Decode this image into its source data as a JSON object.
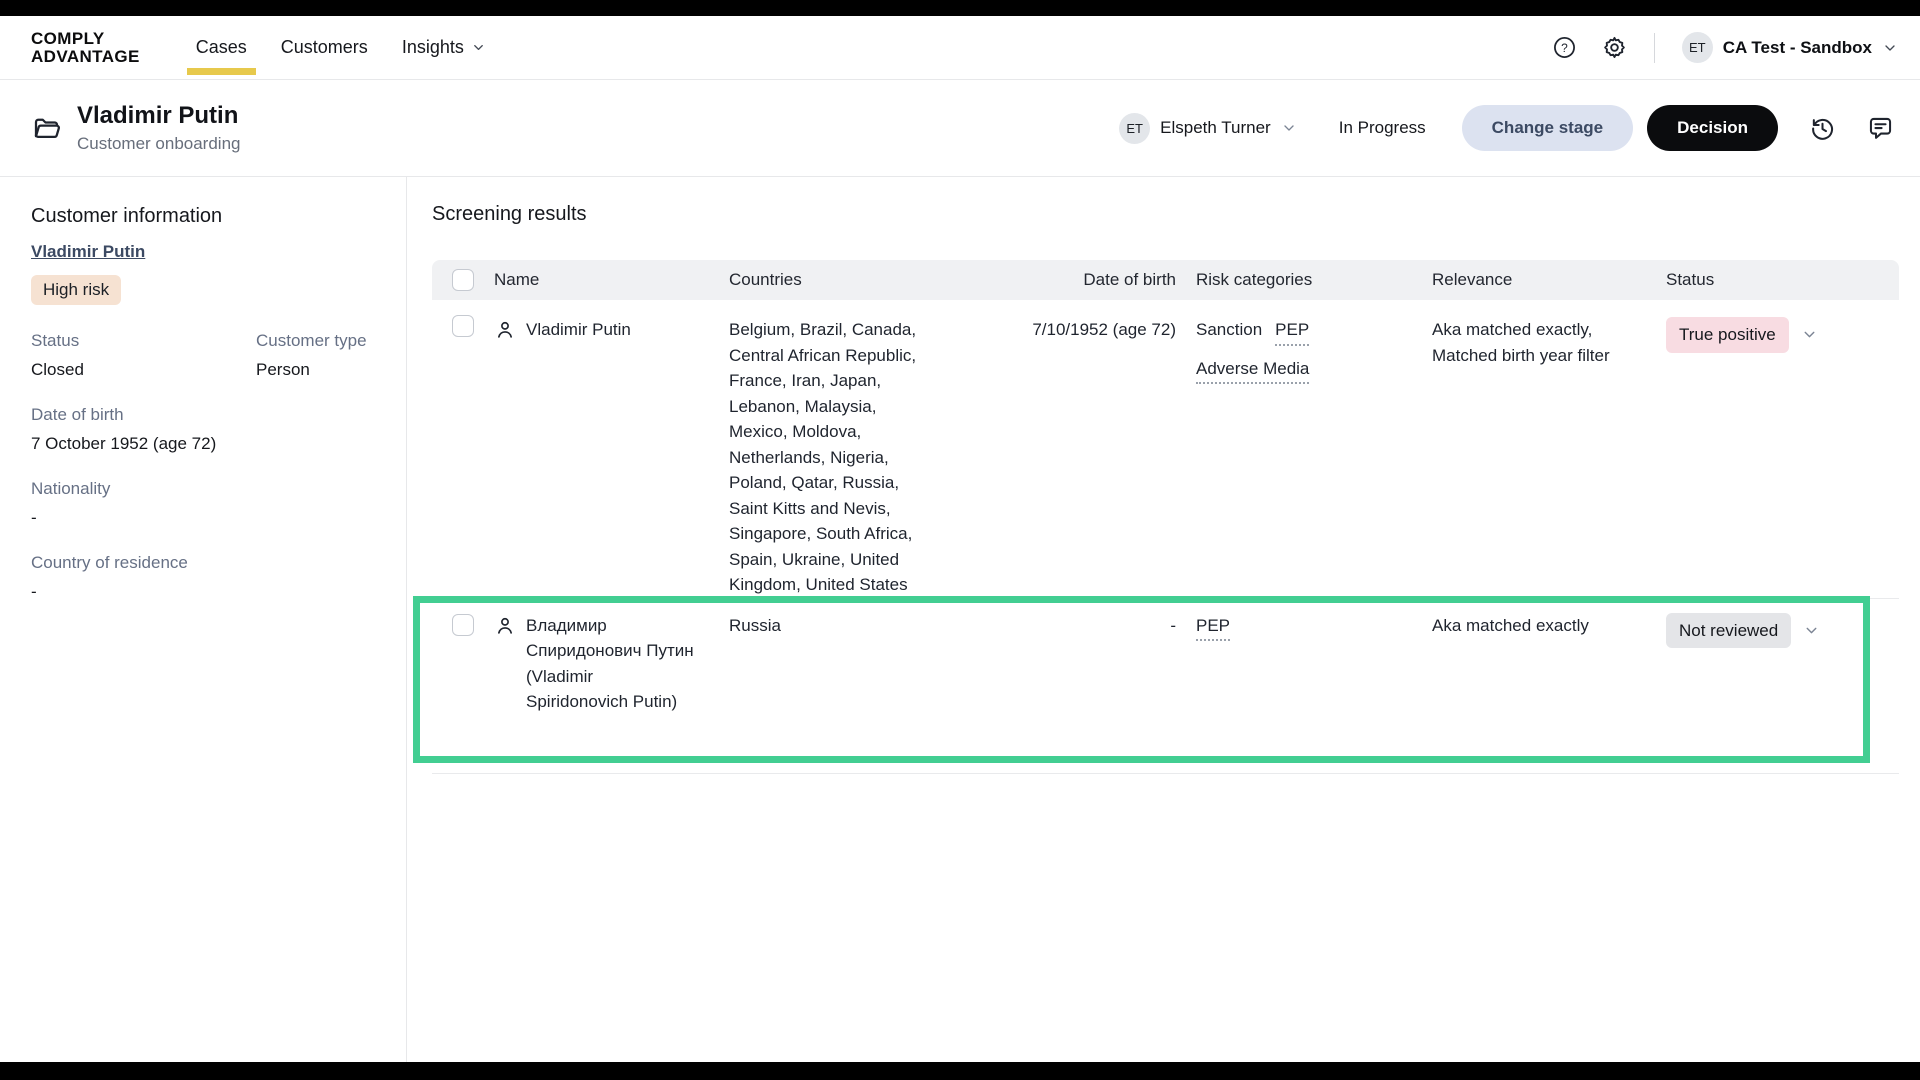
{
  "brand": {
    "logo_line1": "COMPLY",
    "logo_line2": "ADVANTAGE"
  },
  "nav": {
    "tabs": [
      {
        "label": "Cases",
        "active": true
      },
      {
        "label": "Customers",
        "active": false
      },
      {
        "label": "Insights",
        "active": false,
        "has_chevron": true
      }
    ],
    "account": {
      "avatar_initials": "ET",
      "label": "CA Test - Sandbox"
    }
  },
  "case_header": {
    "title": "Vladimir Putin",
    "subtitle": "Customer onboarding",
    "assignee": {
      "avatar_initials": "ET",
      "name": "Elspeth Turner"
    },
    "stage": "In Progress",
    "change_stage_label": "Change stage",
    "decision_label": "Decision"
  },
  "sidebar": {
    "heading": "Customer information",
    "customer_link": "Vladimir Putin",
    "risk_badge": "High risk",
    "fields": [
      {
        "label": "Status",
        "value": "Closed"
      },
      {
        "label": "Customer type",
        "value": "Person"
      },
      {
        "label": "Date of birth",
        "value": "7 October 1952 (age 72)"
      },
      {
        "label": "Nationality",
        "value": "-"
      },
      {
        "label": "Country of residence",
        "value": "-"
      }
    ]
  },
  "main": {
    "heading": "Screening results",
    "table": {
      "columns": [
        "Name",
        "Countries",
        "Date of birth",
        "Risk categories",
        "Relevance",
        "Status"
      ],
      "rows": [
        {
          "name": "Vladimir Putin",
          "countries": "Belgium, Brazil, Canada, Central African Republic, France, Iran, Japan, Lebanon, Malaysia, Mexico, Moldova, Netherlands, Nigeria, Poland, Qatar, Russia, Saint Kitts and Nevis, Singapore, South Africa, Spain, Ukraine, United Kingdom, United States",
          "date_of_birth": "7/10/1952 (age 72)",
          "risk_categories": [
            {
              "label": "Sanction",
              "dotted": false
            },
            {
              "label": "PEP",
              "dotted": true
            },
            {
              "label": "Adverse Media",
              "dotted": true
            }
          ],
          "relevance": "Aka matched exactly, Matched birth year filter",
          "status": {
            "label": "True positive",
            "color": "#f8dce2"
          },
          "highlighted": false
        },
        {
          "name": "Владимир Спиридонович Путин (Vladimir Spiridonovich Putin)",
          "countries": "Russia",
          "date_of_birth": "-",
          "risk_categories": [
            {
              "label": "PEP",
              "dotted": true
            }
          ],
          "relevance": "Aka matched exactly",
          "status": {
            "label": "Not reviewed",
            "color": "#e4e5e8"
          },
          "highlighted": true
        }
      ]
    }
  },
  "icons": {
    "help": "?",
    "gear": "settings-gear",
    "history": "history-clock",
    "comment": "comment-bubble",
    "folder": "case-folder",
    "person": "person-outline",
    "chevron": "chevron-down"
  },
  "colors": {
    "accent_yellow": "#e7c94c",
    "highlight_green": "#42ce92",
    "risk_badge_bg": "#f6e2d2",
    "true_positive_bg": "#f8dce2",
    "not_reviewed_bg": "#e4e5e8",
    "change_stage_bg": "#dce2f0",
    "decision_bg": "#0b0c0e",
    "table_header_bg": "#f0f1f3"
  }
}
